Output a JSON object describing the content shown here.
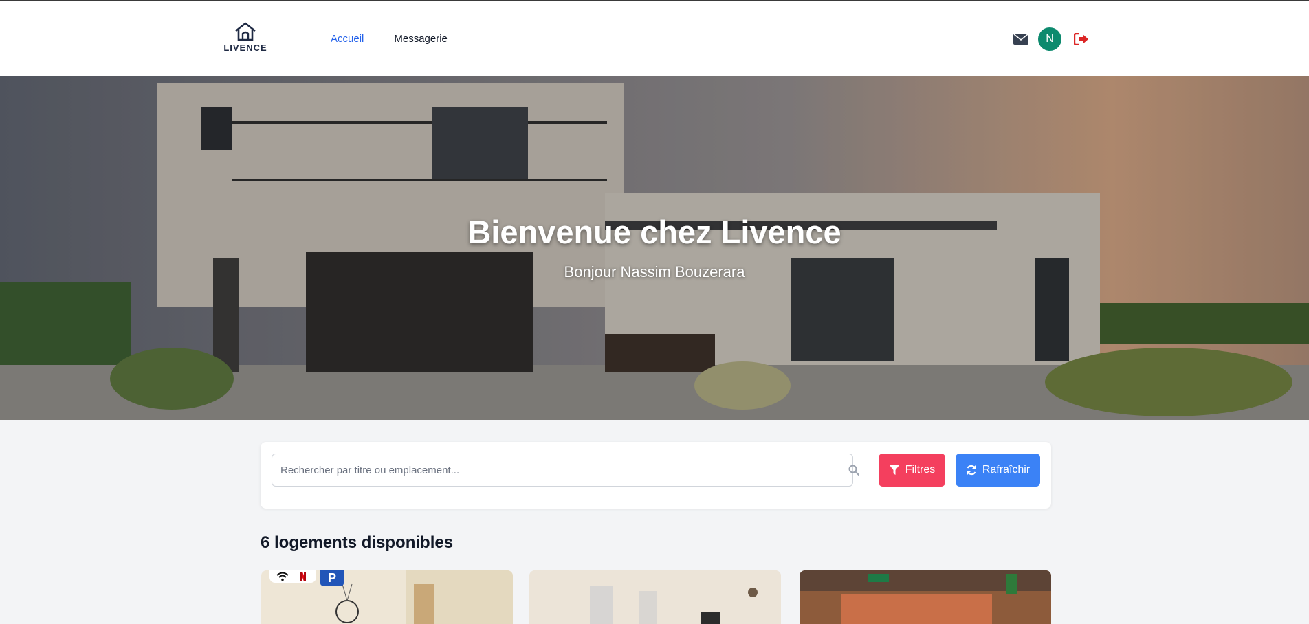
{
  "brand": {
    "logo_text": "LIVENCE"
  },
  "nav": {
    "home_label": "Accueil",
    "messages_label": "Messagerie"
  },
  "user": {
    "avatar_initial": "N"
  },
  "hero": {
    "title": "Bienvenue chez Livence",
    "subtitle": "Bonjour Nassim Bouzerara"
  },
  "search": {
    "placeholder": "Rechercher par titre ou emplacement...",
    "filter_label": "Filtres",
    "refresh_label": "Rafraîchir"
  },
  "listings": {
    "count_label": "6 logements disponibles"
  },
  "amenities": {
    "parking_label": "P"
  },
  "colors": {
    "accent_blue": "#2563eb",
    "filter_button": "#f43f5e",
    "refresh_button": "#3b82f6",
    "avatar": "#0d8a6e",
    "logout": "#dc2626"
  },
  "icons": [
    "home-logo-icon",
    "mail-icon",
    "logout-icon",
    "search-icon",
    "filter-icon",
    "refresh-icon",
    "wifi-icon",
    "netflix-icon",
    "parking-icon"
  ]
}
